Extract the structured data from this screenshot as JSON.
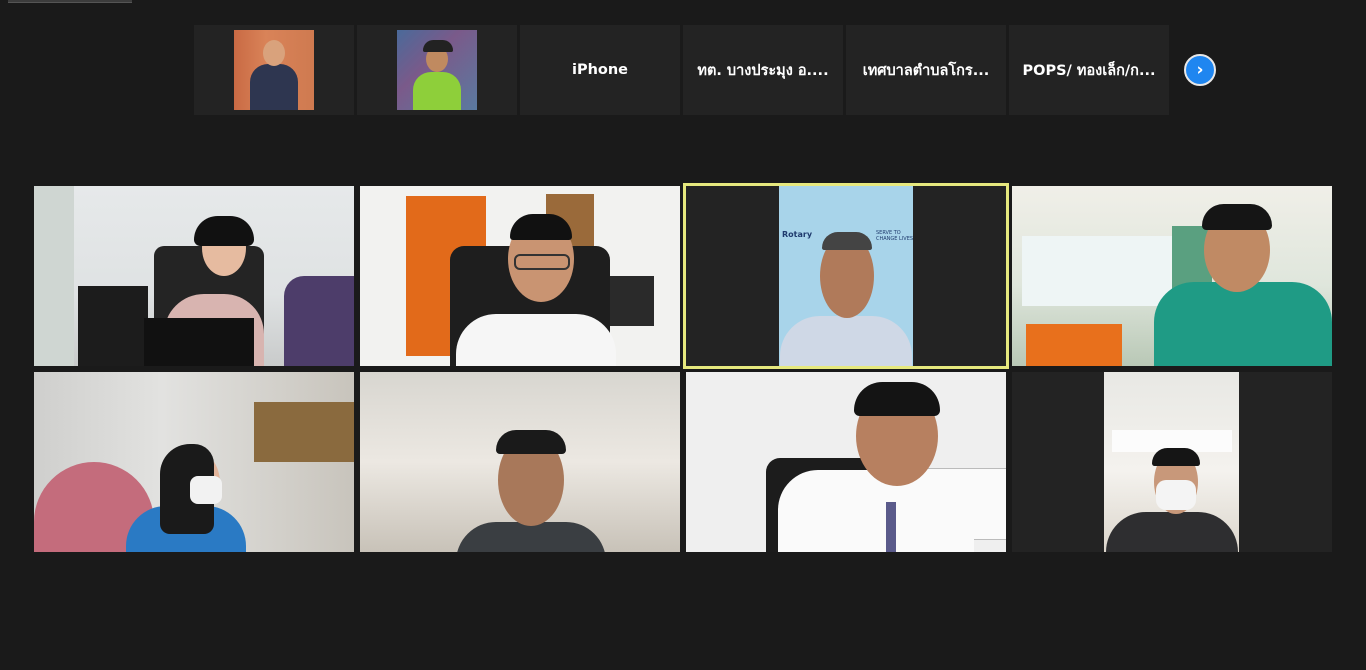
{
  "strip": {
    "tiles": [
      {
        "type": "thumbnail",
        "name": ""
      },
      {
        "type": "thumbnail",
        "name": ""
      },
      {
        "type": "text",
        "name": "iPhone"
      },
      {
        "type": "text",
        "name": "ทต. บางประมุง อ...."
      },
      {
        "type": "text",
        "name": "เทศบาลตำบลโกร..."
      },
      {
        "type": "text",
        "name": "POPS/ ทองเล็ก/ก..."
      }
    ],
    "next_icon": "chevron-right-icon",
    "next_glyph": "›"
  },
  "grid": {
    "active_speaker_index": 2,
    "colors": {
      "active_border": "#e6e87e",
      "next_button": "#1f86f0",
      "background": "#1a1a1a"
    }
  },
  "active_tile_backdrop": {
    "logo_text": "Rotary",
    "logo_text_2": "SERVE TO CHANGE LIVES"
  }
}
